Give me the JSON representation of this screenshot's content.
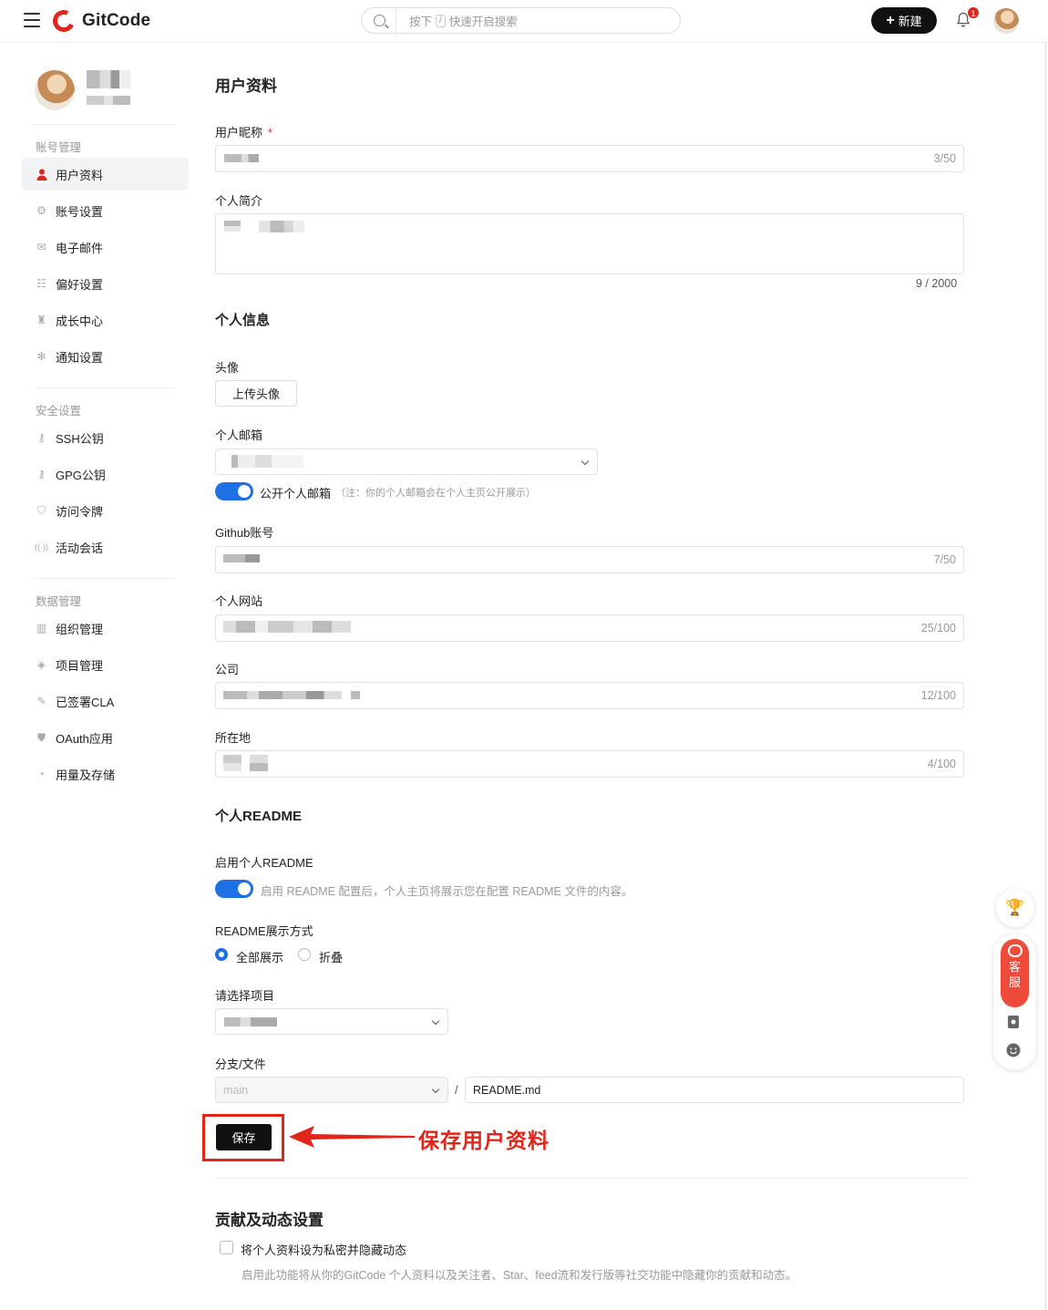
{
  "header": {
    "brand": "GitCode",
    "search": {
      "prefix": "按下",
      "key": "/",
      "suffix": "快速开启搜索"
    },
    "new_label": "新建",
    "notification_count": "1"
  },
  "sidebar": {
    "groups": [
      {
        "label": "账号管理",
        "items": [
          {
            "label": "用户资料",
            "icon": "user-icon",
            "active": true
          },
          {
            "label": "账号设置",
            "icon": "gear-icon"
          },
          {
            "label": "电子邮件",
            "icon": "mail-icon"
          },
          {
            "label": "偏好设置",
            "icon": "sliders-icon"
          },
          {
            "label": "成长中心",
            "icon": "trophy-icon"
          },
          {
            "label": "通知设置",
            "icon": "bell-settings-icon"
          }
        ]
      },
      {
        "label": "安全设置",
        "items": [
          {
            "label": "SSH公钥",
            "icon": "key-icon"
          },
          {
            "label": "GPG公钥",
            "icon": "key-icon"
          },
          {
            "label": "访问令牌",
            "icon": "shield-icon"
          },
          {
            "label": "活动会话",
            "icon": "signal-icon"
          }
        ]
      },
      {
        "label": "数据管理",
        "items": [
          {
            "label": "组织管理",
            "icon": "building-icon"
          },
          {
            "label": "项目管理",
            "icon": "layers-icon"
          },
          {
            "label": "已签署CLA",
            "icon": "sign-icon"
          },
          {
            "label": "OAuth应用",
            "icon": "shield-check-icon"
          },
          {
            "label": "用量及存储",
            "icon": "pie-icon"
          }
        ]
      }
    ]
  },
  "main": {
    "title": "用户资料",
    "nickname": {
      "label": "用户昵称",
      "required": "*",
      "count": "3/50"
    },
    "bio": {
      "label": "个人简介",
      "count": "9 / 2000"
    },
    "personal_info_title": "个人信息",
    "avatar": {
      "label": "头像",
      "upload_label": "上传头像"
    },
    "email": {
      "label": "个人邮箱",
      "toggle_label": "公开个人邮箱",
      "toggle_note": "（注：你的个人邮箱会在个人主页公开展示）",
      "public": true
    },
    "github": {
      "label": "Github账号",
      "count": "7/50"
    },
    "website": {
      "label": "个人网站",
      "count": "25/100"
    },
    "company": {
      "label": "公司",
      "count": "12/100"
    },
    "location": {
      "label": "所在地",
      "count": "4/100"
    },
    "readme_title": "个人README",
    "readme_enable": {
      "label": "启用个人README",
      "hint": "启用 README 配置后，个人主页将展示您在配置 README 文件的内容。",
      "enabled": true
    },
    "readme_mode": {
      "label": "README展示方式",
      "options": [
        "全部展示",
        "折叠"
      ],
      "selected": "全部展示"
    },
    "project": {
      "label": "请选择项目"
    },
    "branch": {
      "label": "分支/文件",
      "branch_placeholder": "main",
      "separator": "/",
      "file": "README.md"
    },
    "save_label": "保存",
    "annotation": "保存用户资料",
    "contrib_title": "贡献及动态设置",
    "private_checkbox_label": "将个人资料设为私密并隐藏动态",
    "private_hint": "启用此功能将从你的GitCode 个人资料以及关注者、Star、feed流和发行版等社交功能中隐藏你的贡献和动态。"
  },
  "floating": {
    "service_label_1": "客",
    "service_label_2": "服"
  },
  "colors": {
    "accent": "#e1251b",
    "primary": "#1f6fe5",
    "dark": "#111111"
  }
}
